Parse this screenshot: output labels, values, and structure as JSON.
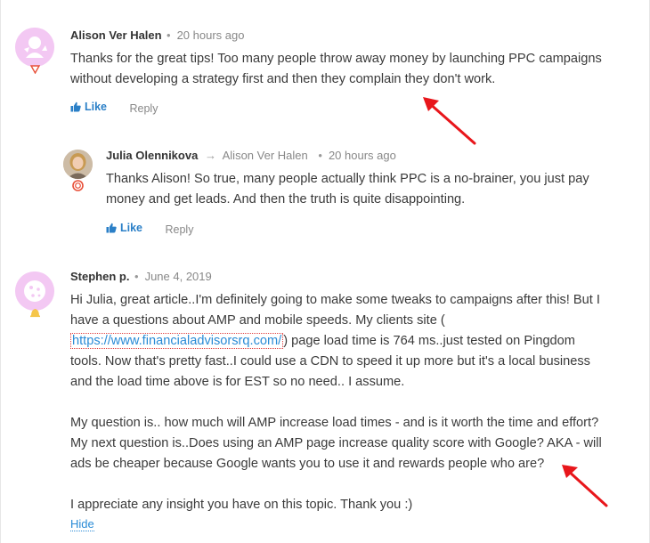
{
  "comments": [
    {
      "author": "Alison Ver Halen",
      "time": "20 hours ago",
      "text_lines": [
        "Thanks for the great tips! Too many people throw away money by launching PPC campaigns",
        "without developing a strategy first and then they complain they don't work."
      ],
      "like_label": "Like",
      "reply_label": "Reply"
    },
    {
      "author": "Julia Olennikova",
      "reply_to": "Alison Ver Halen",
      "time": "20 hours ago",
      "text_lines": [
        "Thanks Alison! So true, many people actually think PPC is a no-brainer, you just pay",
        "money and get leads. And then the truth is quite disappointing."
      ],
      "like_label": "Like",
      "reply_label": "Reply"
    },
    {
      "author": "Stephen p.",
      "time": "June 4, 2019",
      "para1_line1": "Hi Julia, great article..I'm definitely going to make some tweaks to campaigns after this! But I",
      "para1_line2": "have a questions about AMP and mobile speeds. My clients site (",
      "link": "https://www.financialadvisorsrq.com/",
      "para1_line3_after": ") page load time is 764 ms..just tested on Pingdom",
      "para1_line4": "tools. Now that's pretty fast..I could use a CDN to speed it up more but it's a local business",
      "para1_line5": "and the load time above is for EST so no need.. I assume.",
      "para2_line1": "My question is.. how much will AMP increase load times - and is it worth the time and effort?",
      "para2_line2": "My next question is..Does using an AMP page increase quality score with Google? AKA - will",
      "para2_line3": "ads be cheaper because Google wants you to use it and rewards people who are?",
      "para3_line1": "I appreciate any insight you have on this topic. Thank you :)",
      "hide_label": "Hide"
    }
  ],
  "colors": {
    "link": "#2a8bd6",
    "like": "#2a7fc7",
    "arrow": "#e8161b",
    "avatar_pink": "#f3c8f3"
  },
  "icons": [
    "thumbs-up-icon",
    "reply-arrow-icon",
    "red-pointer-arrow"
  ]
}
